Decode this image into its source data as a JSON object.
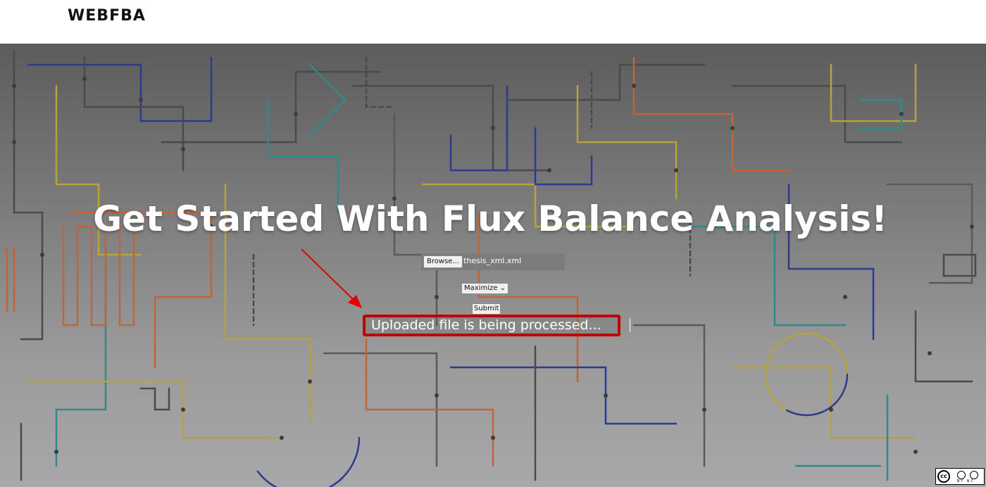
{
  "navbar": {
    "brand": "WEBFBA"
  },
  "hero": {
    "title": "Get Started With Flux Balance Analysis!"
  },
  "form": {
    "browse_label": "Browse...",
    "file_name": "thesis_xml.xml",
    "objective_selected": "Maximize",
    "submit_label": "Submit",
    "status_text": "Uploaded file is being processed..."
  },
  "annotation": {
    "arrow_color": "#e00000",
    "highlight_color": "#c00000"
  },
  "license_badge": {
    "text": "cc",
    "labels": "BY NC"
  },
  "colors": {
    "navbar_bg": "#ffffff",
    "brand_text": "#111111",
    "hero_text": "#ffffff",
    "metro_lines": [
      "#4a4a4a",
      "#2e3a8c",
      "#b8a23a",
      "#c0653a",
      "#2f8a8c",
      "#5a5a5a"
    ]
  },
  "icons": {
    "dropdown": "chevron-down-icon",
    "license": "creative-commons-icon"
  }
}
